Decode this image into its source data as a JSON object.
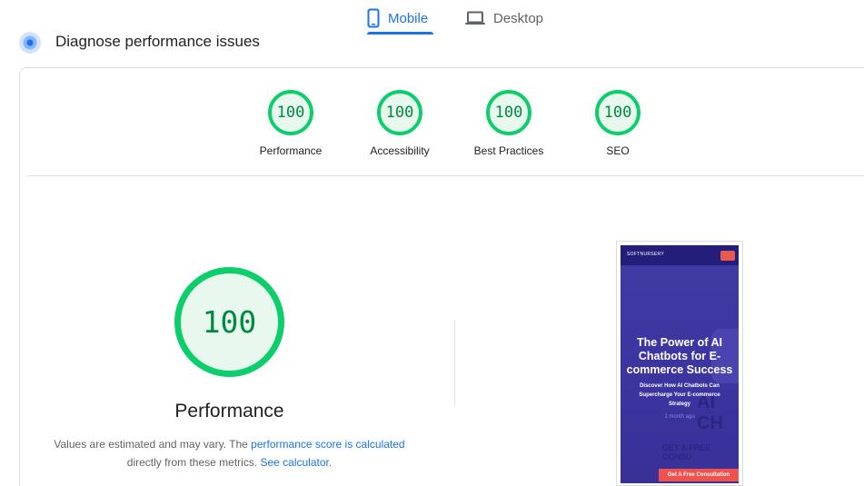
{
  "tabs": [
    {
      "label": "Mobile",
      "icon": "mobile-phone-icon",
      "active": true
    },
    {
      "label": "Desktop",
      "icon": "laptop-icon",
      "active": false
    }
  ],
  "colors": {
    "accent": "#1a73e8",
    "pass_green": "#0cce6b",
    "pass_text": "#008a3e",
    "pass_fill": "#e8f8ee"
  },
  "diagnose": {
    "title": "Diagnose performance issues",
    "icon": "lighthouse-icon"
  },
  "category_scores": [
    {
      "score": "100",
      "label": "Performance"
    },
    {
      "score": "100",
      "label": "Accessibility"
    },
    {
      "score": "100",
      "label": "Best Practices"
    },
    {
      "score": "100",
      "label": "SEO"
    }
  ],
  "main_gauge": {
    "score": "100",
    "title": "Performance",
    "desc_prefix": "Values are estimated and may vary. The ",
    "desc_link": "performance score is calculated",
    "desc_middle": "directly from these metrics. ",
    "desc_link2": "See calculator."
  },
  "thumbnail": {
    "logo": "SOFTNURSERY",
    "heading": "The Power of AI Chatbots for E-commerce Success",
    "subheading": "Discover How AI Chatbots Can Supercharge Your E-commerce Strategy",
    "time": "1 month ago",
    "bg_text": "AI CH",
    "bg_cta": "GET A FREE CONSU",
    "cta": "Get A Free Consultation"
  }
}
